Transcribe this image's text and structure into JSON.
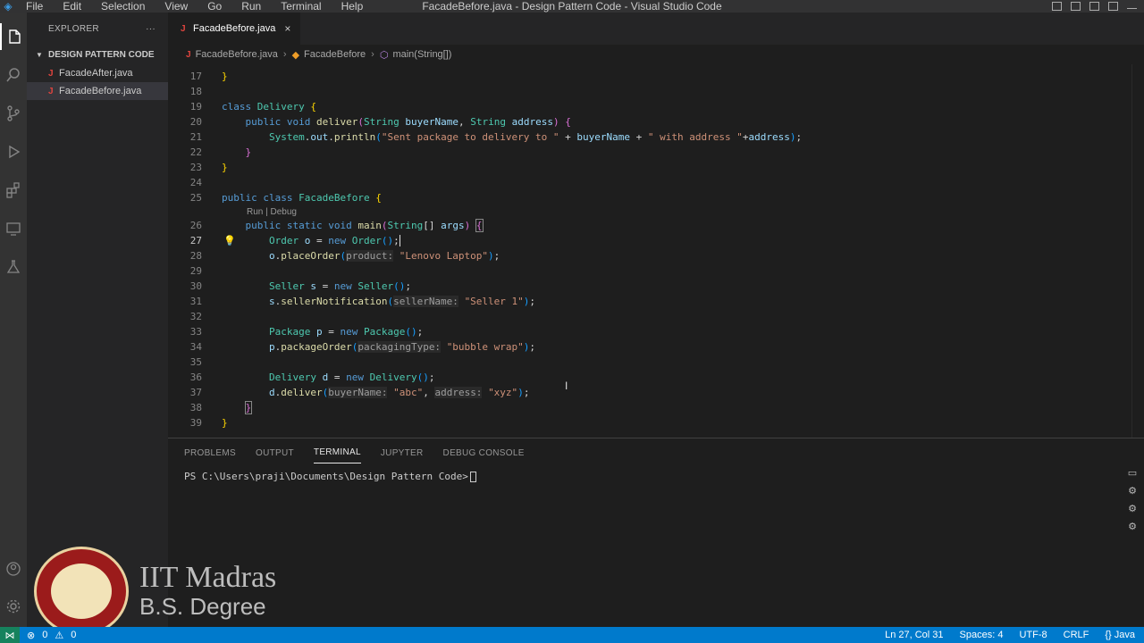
{
  "app": {
    "window_title": "FacadeBefore.java - Design Pattern Code - Visual Studio Code",
    "menu": [
      "File",
      "Edit",
      "Selection",
      "View",
      "Go",
      "Run",
      "Terminal",
      "Help"
    ]
  },
  "sidebar": {
    "header": "EXPLORER",
    "folder": "DESIGN PATTERN CODE",
    "files": [
      {
        "name": "FacadeAfter.java"
      },
      {
        "name": "FacadeBefore.java"
      }
    ]
  },
  "tab": {
    "label": "FacadeBefore.java",
    "close": "×"
  },
  "breadcrumb": {
    "file": "FacadeBefore.java",
    "class": "FacadeBefore",
    "method": "main(String[])"
  },
  "editor": {
    "codelens": "Run | Debug",
    "line_numbers": [
      "17",
      "18",
      "19",
      "20",
      "21",
      "22",
      "23",
      "24",
      "25",
      "26",
      "27",
      "28",
      "29",
      "30",
      "31",
      "32",
      "33",
      "34",
      "35",
      "36",
      "37",
      "38",
      "39"
    ]
  },
  "panel": {
    "tabs": [
      "PROBLEMS",
      "OUTPUT",
      "TERMINAL",
      "JUPYTER",
      "DEBUG CONSOLE"
    ],
    "active_tab": "TERMINAL",
    "prompt": "PS C:\\Users\\praji\\Documents\\Design Pattern Code>"
  },
  "statusbar": {
    "errors": "0",
    "warnings": "0",
    "position": "Ln 27, Col 31",
    "spaces": "Spaces: 4",
    "encoding": "UTF-8",
    "eol": "CRLF",
    "language": "{} Java"
  },
  "watermark": {
    "line1": "IIT Madras",
    "line2": "B.S. Degree"
  }
}
